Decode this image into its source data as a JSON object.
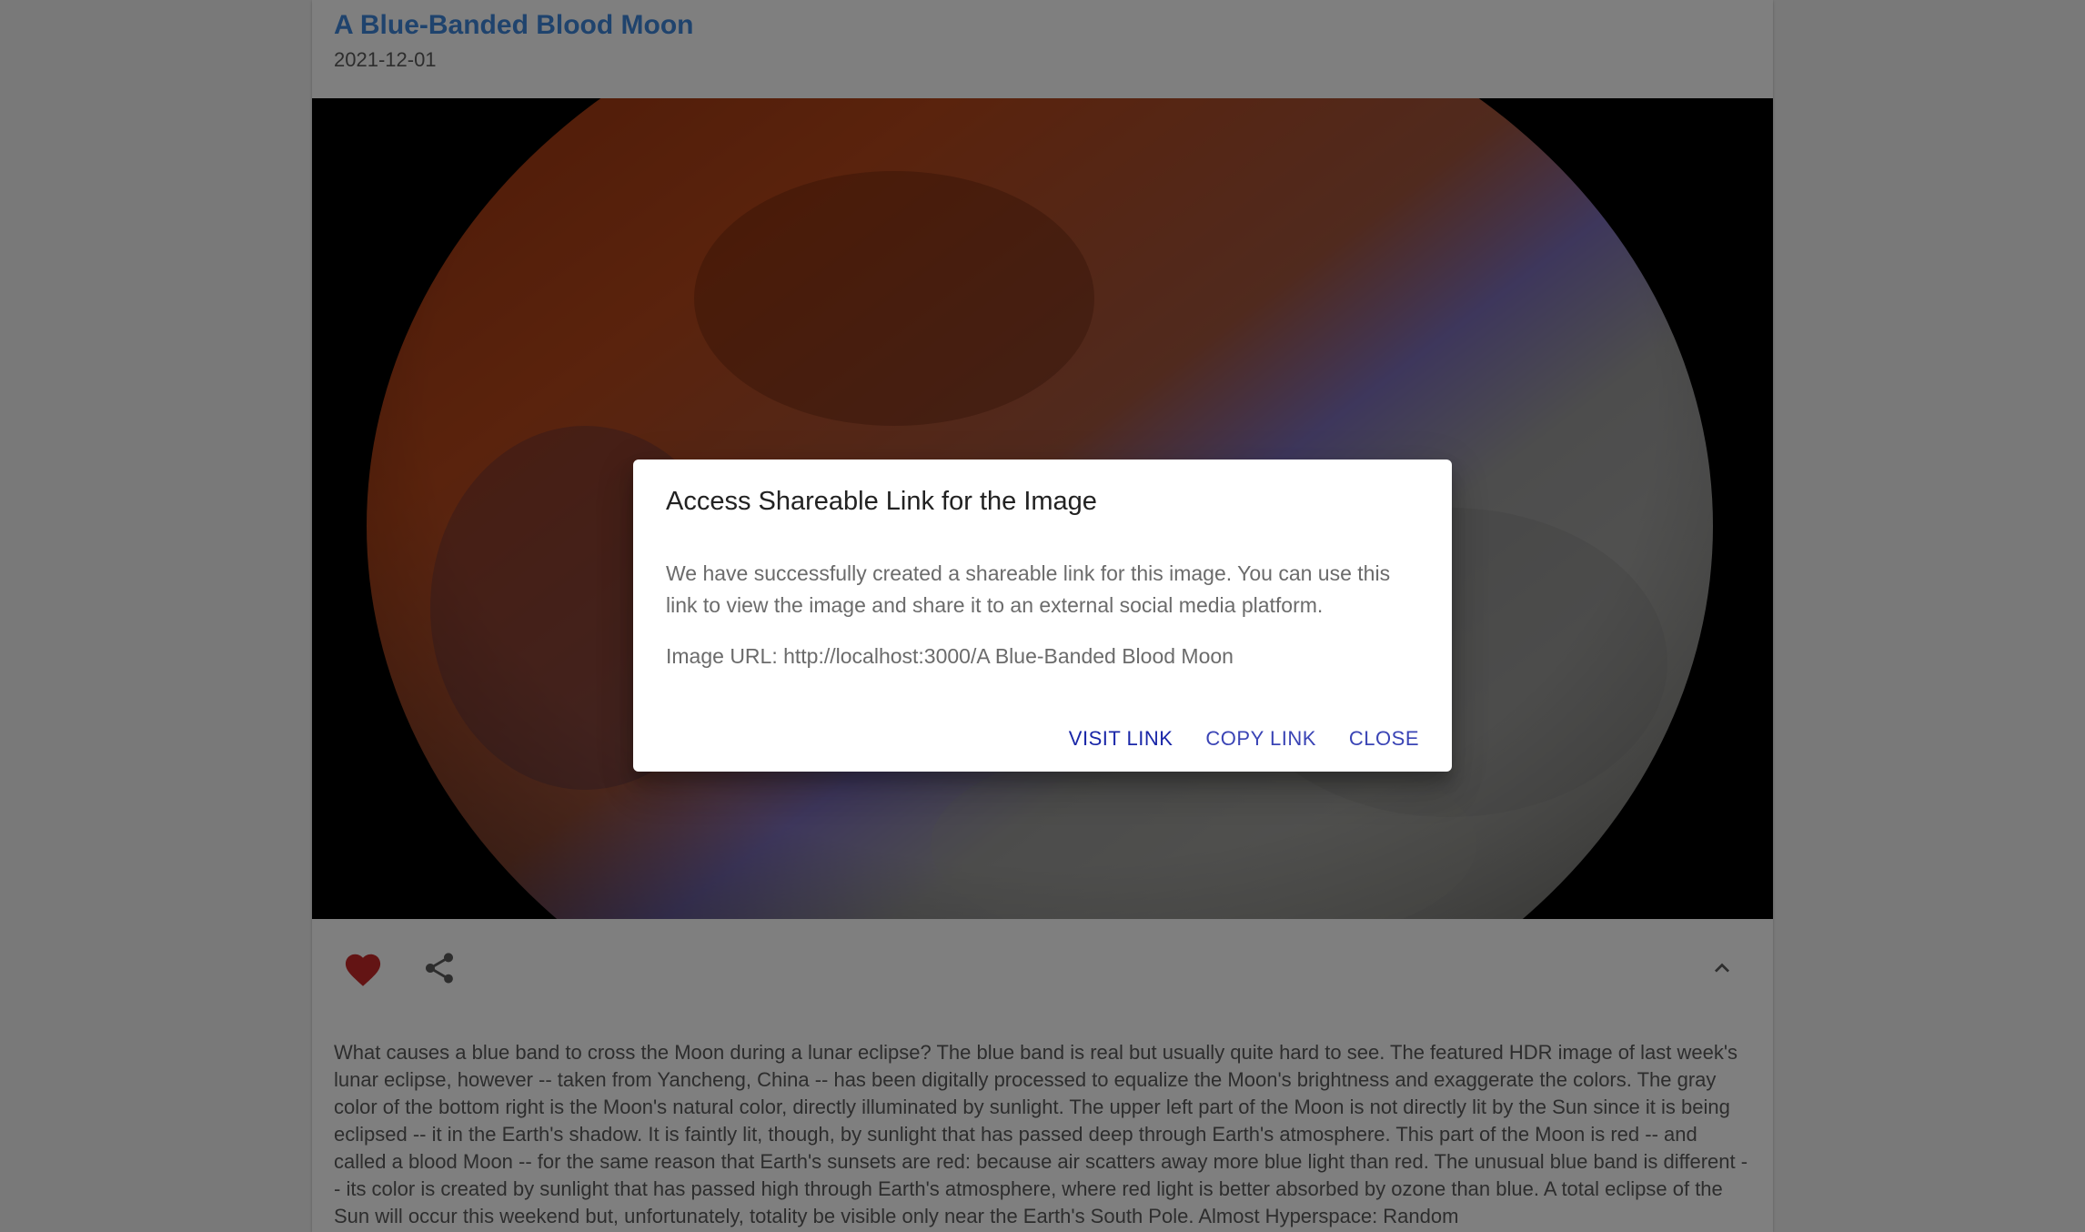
{
  "post": {
    "title": "A Blue-Banded Blood Moon",
    "date": "2021-12-01",
    "image_alt": "A Blue-Banded Blood Moon",
    "description": "What causes a blue band to cross the Moon during a lunar eclipse? The blue band is real but usually quite hard to see. The featured HDR image of last week's lunar eclipse, however -- taken from Yancheng, China -- has been digitally processed to equalize the Moon's brightness and exaggerate the colors. The gray color of the bottom right is the Moon's natural color, directly illuminated by sunlight. The upper left part of the Moon is not directly lit by the Sun since it is being eclipsed -- it in the Earth's shadow. It is faintly lit, though, by sunlight that has passed deep through Earth's atmosphere. This part of the Moon is red -- and called a blood Moon -- for the same reason that Earth's sunsets are red: because air scatters away more blue light than red. The unusual blue band is different -- its color is created by sunlight that has passed high through Earth's atmosphere, where red light is better absorbed by ozone than blue. A total eclipse of the Sun will occur this weekend but, unfortunately, totality be visible only near the Earth's South Pole. Almost Hyperspace: Random",
    "actions": {
      "like_icon": "heart-icon",
      "share_icon": "share-icon",
      "expand_icon": "chevron-up-icon",
      "like_color": "#c62828"
    }
  },
  "dialog": {
    "title": "Access Shareable Link for the Image",
    "text": "We have successfully created a shareable link for this image. You can use this link to view the image and share it to an external social media platform.",
    "url_line": "Image URL: http://localhost:3000/A Blue-Banded Blood Moon",
    "buttons": {
      "visit": "VISIT LINK",
      "copy": "COPY LINK",
      "close": "CLOSE"
    }
  },
  "colors": {
    "title": "#3f86db",
    "primary_button": "#1a27a8",
    "backdrop": "rgba(0,0,0,0.5)"
  }
}
